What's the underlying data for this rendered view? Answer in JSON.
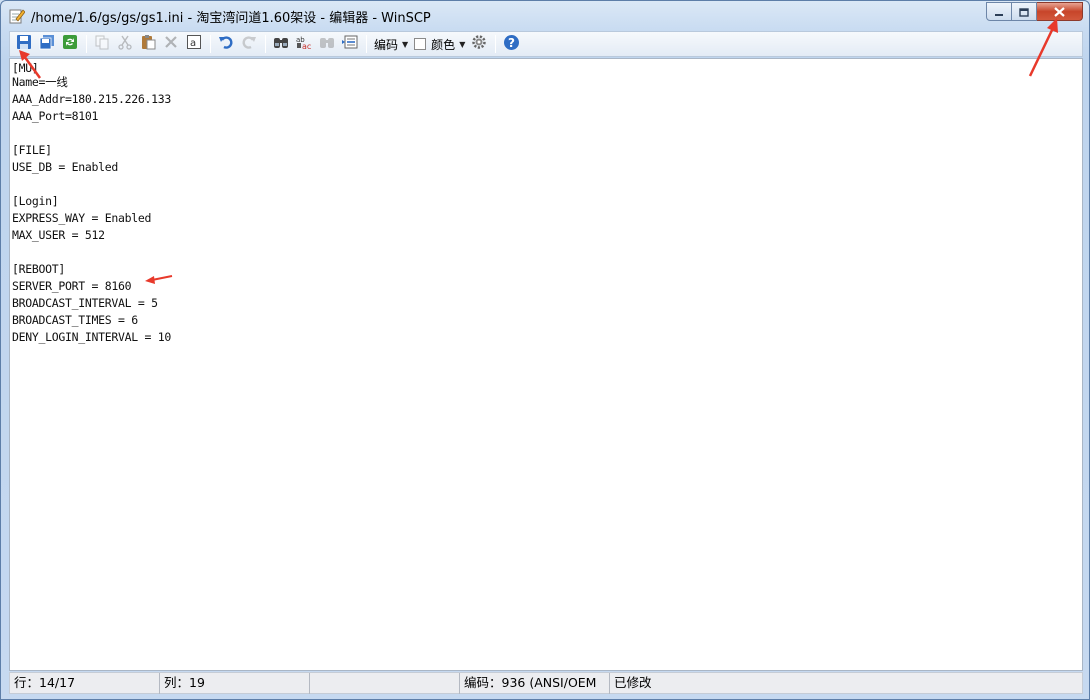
{
  "window": {
    "title": "/home/1.6/gs/gs/gs1.ini - 淘宝湾问道1.60架设 - 编辑器 - WinSCP"
  },
  "caption_buttons": {
    "minimize_icon": "minimize-icon",
    "maximize_icon": "maximize-icon",
    "close_icon": "close-icon"
  },
  "toolbar": {
    "encoding_label": "编码",
    "color_label": "颜色",
    "icons": [
      "save-icon",
      "save-all-icon",
      "reload-icon",
      "copy-icon",
      "cut-icon",
      "paste-icon",
      "delete-icon",
      "select-all-icon",
      "undo-icon",
      "redo-icon",
      "find-icon",
      "replace-icon",
      "find-next-icon",
      "goto-line-icon",
      "settings-icon",
      "help-icon"
    ]
  },
  "editor": {
    "lines": [
      "[MU]",
      "Name=一线",
      "AAA_Addr=180.215.226.133",
      "AAA_Port=8101",
      "",
      "[FILE]",
      "USE_DB = Enabled",
      "",
      "[Login]",
      "EXPRESS_WAY = Enabled",
      "MAX_USER = 512",
      "",
      "[REBOOT]",
      "SERVER_PORT = 8160",
      "BROADCAST_INTERVAL = 5",
      "BROADCAST_TIMES = 6",
      "DENY_LOGIN_INTERVAL = 10"
    ]
  },
  "statusbar": {
    "line": "行：14/17",
    "column": "列：19",
    "empty": "",
    "encoding": "编码：936  (ANSI/OEM",
    "modified": "已修改"
  },
  "colors": {
    "annotation_arrow": "#e8392b",
    "close_button": "#c7452a"
  }
}
